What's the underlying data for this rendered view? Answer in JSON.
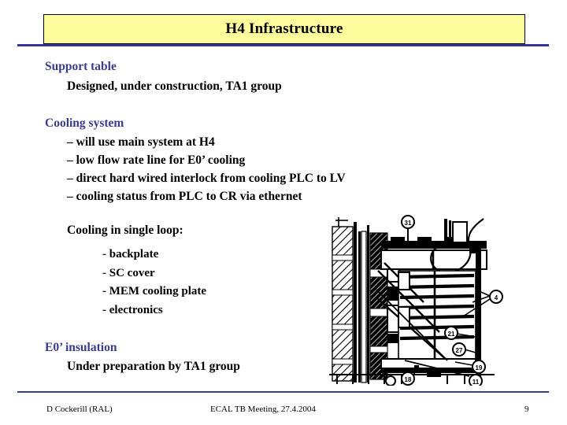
{
  "slide": {
    "title": "H4 Infrastructure",
    "title_bg_color": "#fcfc9d",
    "heading_color": "#3b3b8c",
    "rule_color": "#333399"
  },
  "sections": [
    {
      "heading": "Support table",
      "items": [
        "Designed, under construction, TA1 group"
      ]
    },
    {
      "heading": "Cooling system",
      "items": [
        "– will use main system at H4",
        "– low flow rate line for E0’ cooling",
        "– direct hard wired interlock from cooling PLC to LV",
        "– cooling status from PLC to CR via ethernet"
      ],
      "subgroup": {
        "title": "Cooling in single loop:",
        "items": [
          "- backplate",
          "- SC cover",
          "- MEM cooling plate",
          "- electronics"
        ]
      }
    },
    {
      "heading": "E0’ insulation",
      "items": [
        "Under preparation by TA1 group"
      ]
    }
  ],
  "figure": {
    "name": "cooling-loop-cross-section-drawing",
    "description": "Black and white CAD cross-section of the cooling assembly with hatched wall, horizontal cooling fins, vertical column, curved pipe loop and numbered balloon callouts",
    "callouts": [
      "31",
      "4",
      "21",
      "27",
      "19",
      "11",
      "18"
    ]
  },
  "footer": {
    "author": "D Cockerill (RAL)",
    "center": "ECAL TB Meeting, 27.4.2004",
    "page": "9"
  }
}
